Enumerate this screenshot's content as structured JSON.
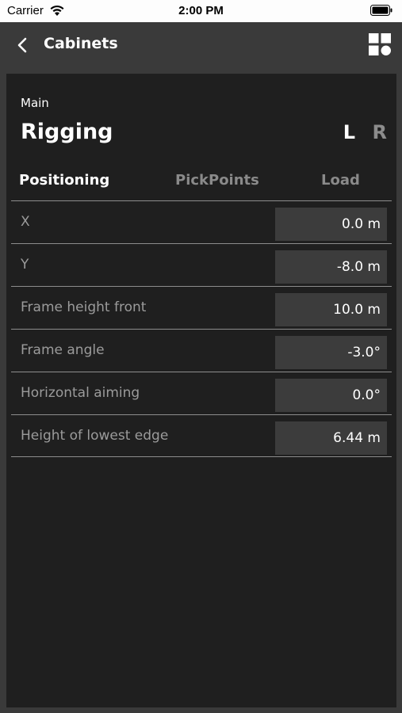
{
  "status_bar": {
    "carrier": "Carrier",
    "time": "2:00 PM"
  },
  "nav": {
    "title": "Cabinets",
    "back_icon": "chevron-left-icon",
    "grid_icon": "grid-icon"
  },
  "section": {
    "label": "Main",
    "title": "Rigging",
    "side_l": "L",
    "side_r": "R"
  },
  "tabs": [
    {
      "label": "Positioning",
      "selected": true
    },
    {
      "label": "PickPoints",
      "selected": false
    },
    {
      "label": "Load",
      "selected": false
    }
  ],
  "rows": [
    {
      "label": "X",
      "value": "0.0 m"
    },
    {
      "label": "Y",
      "value": "-8.0 m"
    },
    {
      "label": "Frame height front",
      "value": "10.0 m"
    },
    {
      "label": "Frame angle",
      "value": "-3.0°"
    },
    {
      "label": "Horizontal aiming",
      "value": "0.0°"
    },
    {
      "label": "Height of lowest edge",
      "value": "6.44 m"
    }
  ],
  "colors": {
    "background": "#3a3a3a",
    "panel": "#1f1f1f",
    "field": "#3c3c3c",
    "inactive": "#8a8a8a"
  }
}
